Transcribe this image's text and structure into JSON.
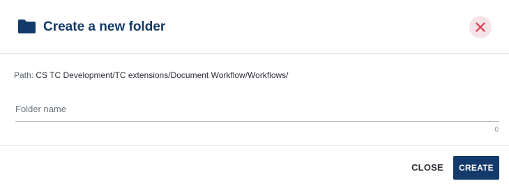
{
  "dialog": {
    "title": "Create a new folder",
    "icons": {
      "title_icon": "folder-icon",
      "close_icon": "close-icon"
    },
    "colors": {
      "primary": "#123a6b",
      "close_bg": "#f6e3e7",
      "close_x": "#d9495e"
    }
  },
  "path": {
    "label": "Path:",
    "value": "CS TC Development/TC extensions/Document Workflow/Workflows/"
  },
  "folder_name": {
    "placeholder": "Folder name",
    "value": "",
    "char_count": "0"
  },
  "actions": {
    "close_label": "CLOSE",
    "create_label": "CREATE"
  }
}
